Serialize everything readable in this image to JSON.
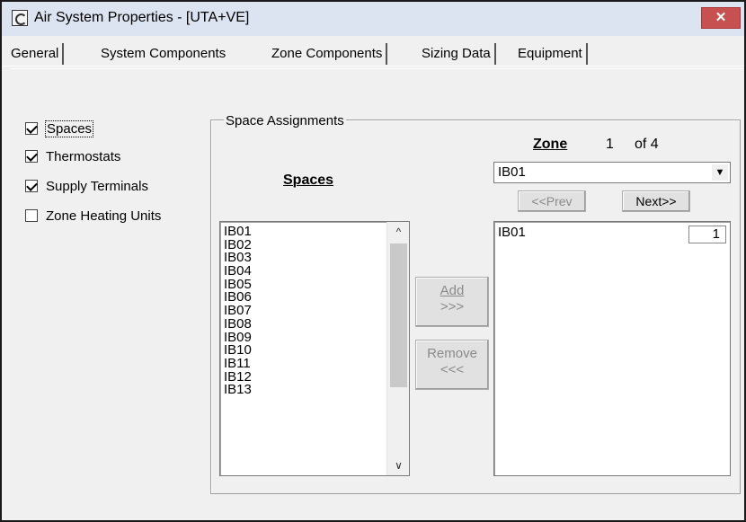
{
  "window": {
    "title": "Air System Properties - [UTA+VE]",
    "close_label": "✕"
  },
  "tabs": [
    {
      "label": "General"
    },
    {
      "label": "System Components"
    },
    {
      "label": "Zone Components",
      "active": true
    },
    {
      "label": "Sizing Data"
    },
    {
      "label": "Equipment"
    }
  ],
  "components": [
    {
      "label": "Spaces",
      "checked": true
    },
    {
      "label": "Thermostats",
      "checked": true
    },
    {
      "label": "Supply Terminals",
      "checked": true
    },
    {
      "label": "Zone Heating Units",
      "checked": false
    }
  ],
  "space_assignments": {
    "group_label": "Space Assignments",
    "spaces_label": "Spaces",
    "spaces_list": [
      "IB01",
      "IB02",
      "IB03",
      "IB04",
      "IB05",
      "IB06",
      "IB07",
      "IB08",
      "IB09",
      "IB10",
      "IB11",
      "IB12",
      "IB13"
    ],
    "add_button": {
      "line1": "Add",
      "line2": ">>>"
    },
    "remove_button": {
      "line1": "Remove",
      "line2": "<<<"
    },
    "zone": {
      "label": "Zone",
      "current": "1",
      "of_text": "of  4",
      "selected": "IB01",
      "prev_label": "<<Prev",
      "next_label": "Next>>"
    },
    "assigned": [
      {
        "name": "IB01",
        "count": "1"
      }
    ]
  },
  "icons": {
    "scroll_up": "chevron-up-icon",
    "scroll_down": "chevron-down-icon",
    "combo_arrow": "dropdown-arrow-icon"
  }
}
